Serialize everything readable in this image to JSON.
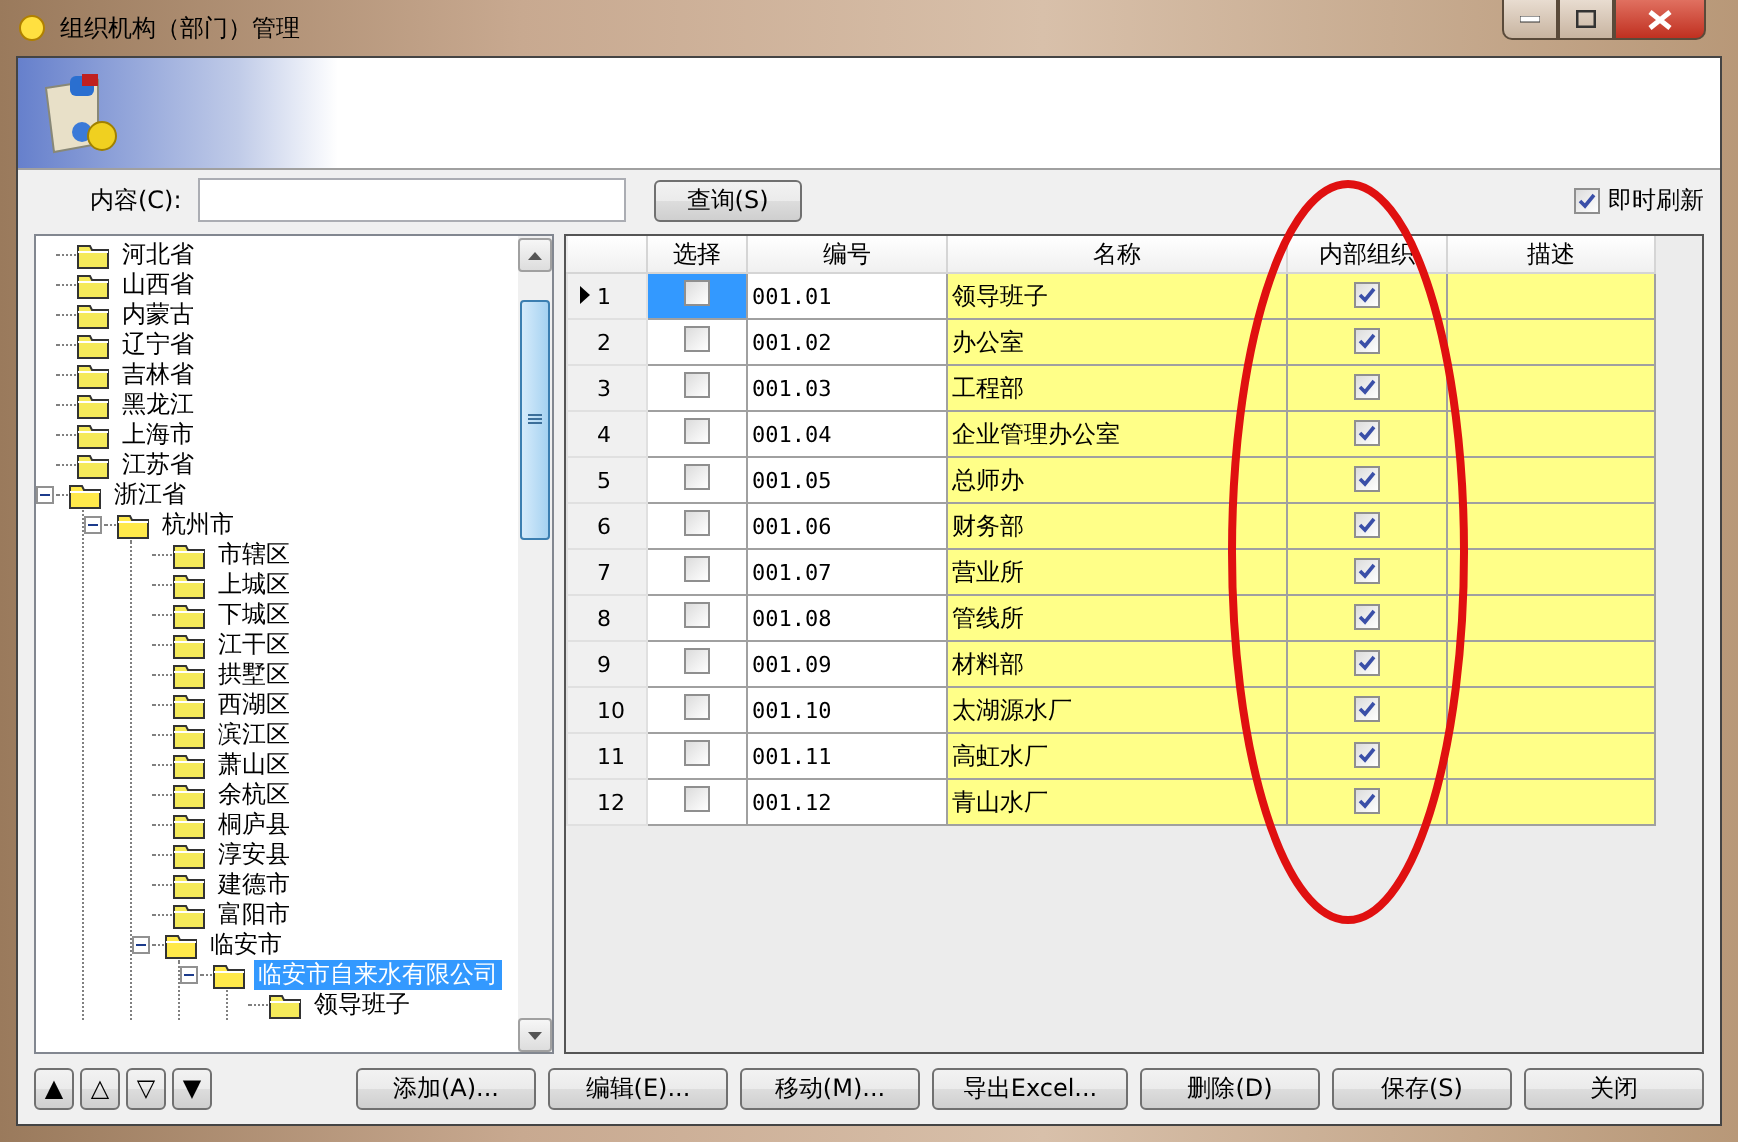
{
  "window": {
    "title": "组织机构（部门）管理"
  },
  "search": {
    "label": "内容(C):",
    "button": "查询(S)"
  },
  "auto_refresh": {
    "label": "即时刷新",
    "checked": true
  },
  "tree": [
    {
      "label": "河北省",
      "selected": false
    },
    {
      "label": "山西省",
      "selected": false
    },
    {
      "label": "内蒙古",
      "selected": false
    },
    {
      "label": "辽宁省",
      "selected": false
    },
    {
      "label": "吉林省",
      "selected": false
    },
    {
      "label": "黑龙江",
      "selected": false
    },
    {
      "label": "上海市",
      "selected": false
    },
    {
      "label": "江苏省",
      "selected": false
    },
    {
      "label": "浙江省",
      "expanded": true,
      "selected": false,
      "children": [
        {
          "label": "杭州市",
          "expanded": true,
          "selected": false,
          "children": [
            {
              "label": "市辖区",
              "selected": false
            },
            {
              "label": "上城区",
              "selected": false
            },
            {
              "label": "下城区",
              "selected": false
            },
            {
              "label": "江干区",
              "selected": false
            },
            {
              "label": "拱墅区",
              "selected": false
            },
            {
              "label": "西湖区",
              "selected": false
            },
            {
              "label": "滨江区",
              "selected": false
            },
            {
              "label": "萧山区",
              "selected": false
            },
            {
              "label": "余杭区",
              "selected": false
            },
            {
              "label": "桐庐县",
              "selected": false
            },
            {
              "label": "淳安县",
              "selected": false
            },
            {
              "label": "建德市",
              "selected": false
            },
            {
              "label": "富阳市",
              "selected": false
            },
            {
              "label": "临安市",
              "expanded": true,
              "selected": false,
              "children": [
                {
                  "label": "临安市自来水有限公司",
                  "expanded": true,
                  "selected": true,
                  "children": [
                    {
                      "label": "领导班子",
                      "selected": false
                    }
                  ]
                }
              ]
            }
          ]
        }
      ]
    }
  ],
  "nav_buttons": [
    "▲",
    "△",
    "▽",
    "▼"
  ],
  "table": {
    "columns": [
      "选择",
      "编号",
      "名称",
      "内部组织",
      "描述"
    ],
    "rows": [
      {
        "number": "1",
        "current": true,
        "selected": false,
        "code": "001.01",
        "name": "领导班子",
        "internal": true
      },
      {
        "number": "2",
        "current": false,
        "selected": false,
        "code": "001.02",
        "name": "办公室",
        "internal": true
      },
      {
        "number": "3",
        "current": false,
        "selected": false,
        "code": "001.03",
        "name": "工程部",
        "internal": true
      },
      {
        "number": "4",
        "current": false,
        "selected": false,
        "code": "001.04",
        "name": "企业管理办公室",
        "internal": true
      },
      {
        "number": "5",
        "current": false,
        "selected": false,
        "code": "001.05",
        "name": "总师办",
        "internal": true
      },
      {
        "number": "6",
        "current": false,
        "selected": false,
        "code": "001.06",
        "name": "财务部",
        "internal": true
      },
      {
        "number": "7",
        "current": false,
        "selected": false,
        "code": "001.07",
        "name": "营业所",
        "internal": true
      },
      {
        "number": "8",
        "current": false,
        "selected": false,
        "code": "001.08",
        "name": "管线所",
        "internal": true
      },
      {
        "number": "9",
        "current": false,
        "selected": false,
        "code": "001.09",
        "name": "材料部",
        "internal": true
      },
      {
        "number": "10",
        "current": false,
        "selected": false,
        "code": "001.10",
        "name": "太湖源水厂",
        "internal": true
      },
      {
        "number": "11",
        "current": false,
        "selected": false,
        "code": "001.11",
        "name": "高虹水厂",
        "internal": true
      },
      {
        "number": "12",
        "current": false,
        "selected": false,
        "code": "001.12",
        "name": "青山水厂",
        "internal": true
      }
    ]
  },
  "buttons": [
    "添加(A)...",
    "编辑(E)...",
    "移动(M)...",
    "导出Excel...",
    "删除(D)",
    "保存(S)",
    "关闭"
  ],
  "annotations": [
    {
      "kind": "ellipse"
    }
  ]
}
